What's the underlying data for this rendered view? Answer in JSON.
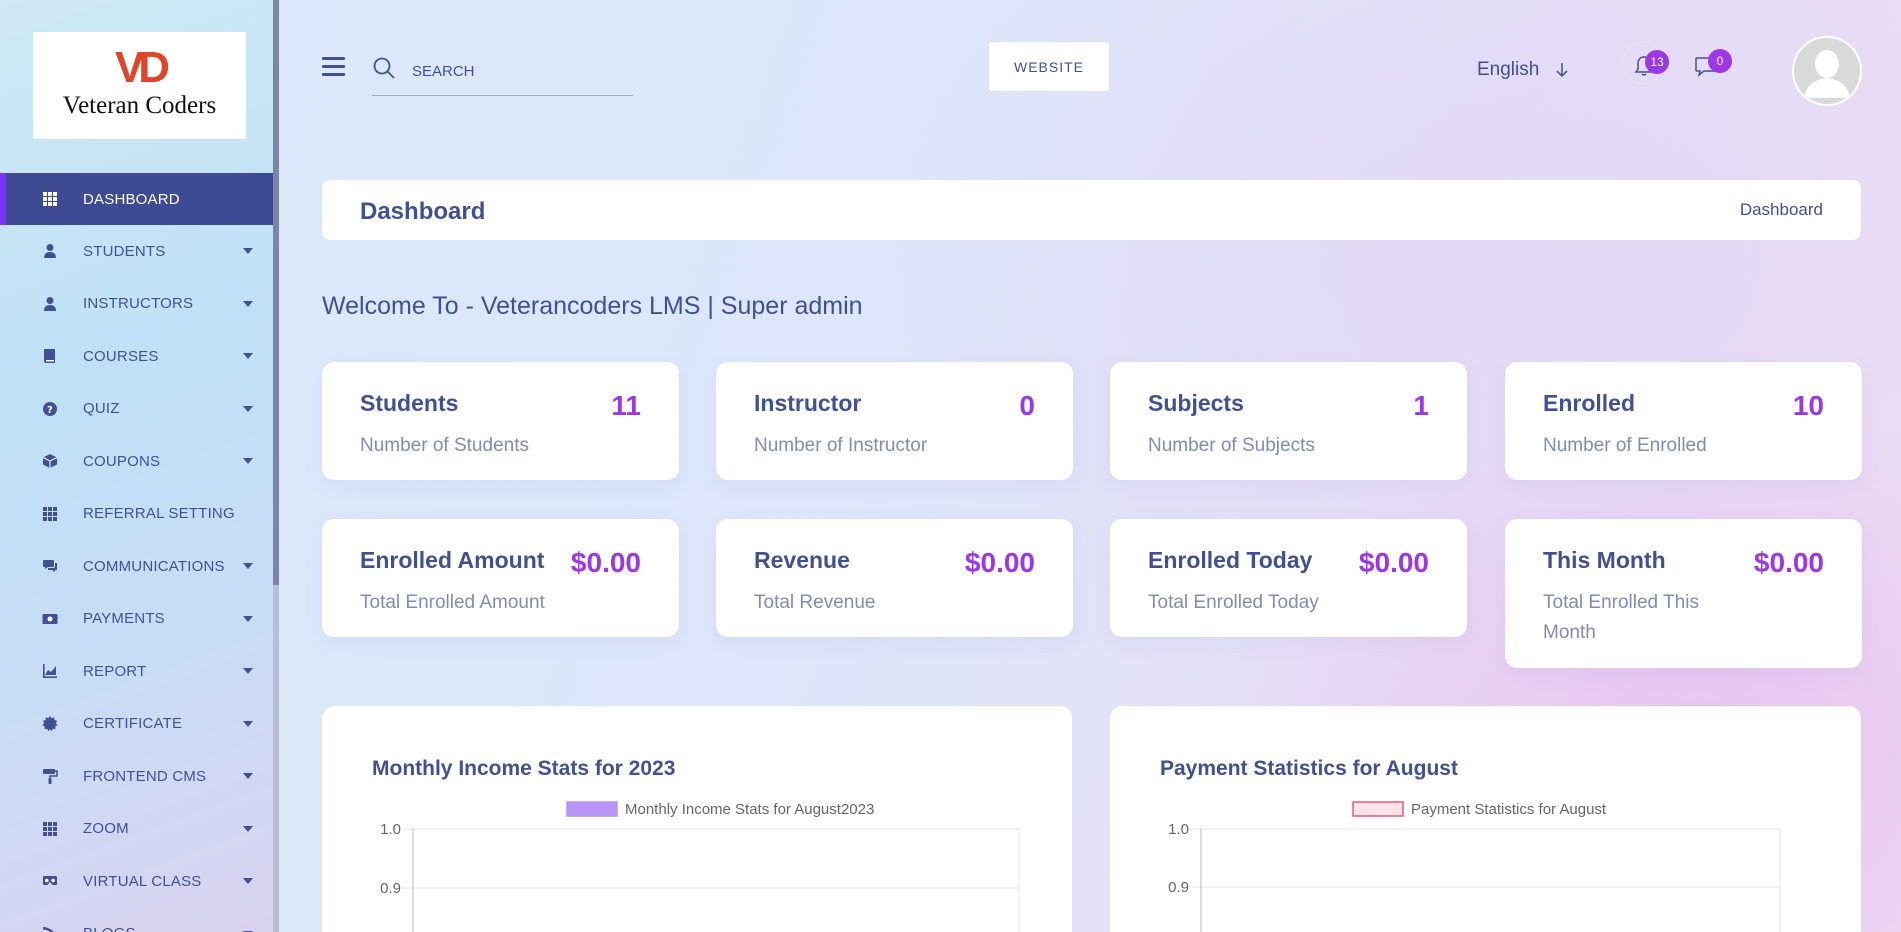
{
  "sidebar": {
    "logo_mark": "VD",
    "logo_text": "Veteran Coders",
    "items": [
      {
        "label": "DASHBOARD",
        "icon": "grid-icon",
        "active": true,
        "caret": false
      },
      {
        "label": "STUDENTS",
        "icon": "user-icon",
        "active": false,
        "caret": true
      },
      {
        "label": "INSTRUCTORS",
        "icon": "user-icon",
        "active": false,
        "caret": true
      },
      {
        "label": "COURSES",
        "icon": "book-icon",
        "active": false,
        "caret": true
      },
      {
        "label": "QUIZ",
        "icon": "question-icon",
        "active": false,
        "caret": true
      },
      {
        "label": "COUPONS",
        "icon": "box-icon",
        "active": false,
        "caret": true
      },
      {
        "label": "REFERRAL SETTING",
        "icon": "grid-icon",
        "active": false,
        "caret": false
      },
      {
        "label": "COMMUNICATIONS",
        "icon": "chat-icon",
        "active": false,
        "caret": true
      },
      {
        "label": "PAYMENTS",
        "icon": "money-icon",
        "active": false,
        "caret": true
      },
      {
        "label": "REPORT",
        "icon": "chart-icon",
        "active": false,
        "caret": true
      },
      {
        "label": "CERTIFICATE",
        "icon": "certificate-icon",
        "active": false,
        "caret": true
      },
      {
        "label": "FRONTEND CMS",
        "icon": "paint-roller-icon",
        "active": false,
        "caret": true
      },
      {
        "label": "ZOOM",
        "icon": "grid-icon",
        "active": false,
        "caret": true
      },
      {
        "label": "VIRTUAL CLASS",
        "icon": "vr-icon",
        "active": false,
        "caret": true
      },
      {
        "label": "BLOGS",
        "icon": "rss-icon",
        "active": false,
        "caret": true
      }
    ]
  },
  "topbar": {
    "search_placeholder": "SEARCH",
    "website_label": "WEBSITE",
    "language": "English",
    "notifications_count": "13",
    "messages_count": "0"
  },
  "breadcrumb": {
    "title": "Dashboard",
    "current": "Dashboard"
  },
  "welcome": "Welcome To - Veterancoders LMS | Super admin",
  "stats": [
    {
      "title": "Students",
      "value": "11",
      "sub": "Number of Students"
    },
    {
      "title": "Instructor",
      "value": "0",
      "sub": "Number of Instructor"
    },
    {
      "title": "Subjects",
      "value": "1",
      "sub": "Number of Subjects"
    },
    {
      "title": "Enrolled",
      "value": "10",
      "sub": "Number of Enrolled"
    },
    {
      "title": "Enrolled Amount",
      "value": "$0.00",
      "sub": "Total Enrolled Amount"
    },
    {
      "title": "Revenue",
      "value": "$0.00",
      "sub": "Total Revenue"
    },
    {
      "title": "Enrolled Today",
      "value": "$0.00",
      "sub": "Total Enrolled Today"
    },
    {
      "title": "This Month",
      "value": "$0.00",
      "sub": "Total Enrolled This Month"
    }
  ],
  "colors": {
    "accent": "#9c36e8",
    "primary": "#415094",
    "active_bg": "#3e4a93",
    "active_bar": "#7c32ff",
    "income_legend": "#b794f6",
    "payment_legend": "#fde2e8"
  },
  "chart_data": [
    {
      "type": "bar",
      "title": "Monthly Income Stats for 2023",
      "series": [
        {
          "name": "Monthly Income Stats for August2023",
          "values": []
        }
      ],
      "yticks": [
        "1.0",
        "0.9"
      ],
      "ylim": [
        0.9,
        1.0
      ],
      "grid": true,
      "legend": "top"
    },
    {
      "type": "bar",
      "title": "Payment Statistics for August",
      "series": [
        {
          "name": "Payment Statistics for August",
          "values": []
        }
      ],
      "yticks": [
        "1.0",
        "0.9"
      ],
      "ylim": [
        0.9,
        1.0
      ],
      "grid": true,
      "legend": "top"
    }
  ]
}
